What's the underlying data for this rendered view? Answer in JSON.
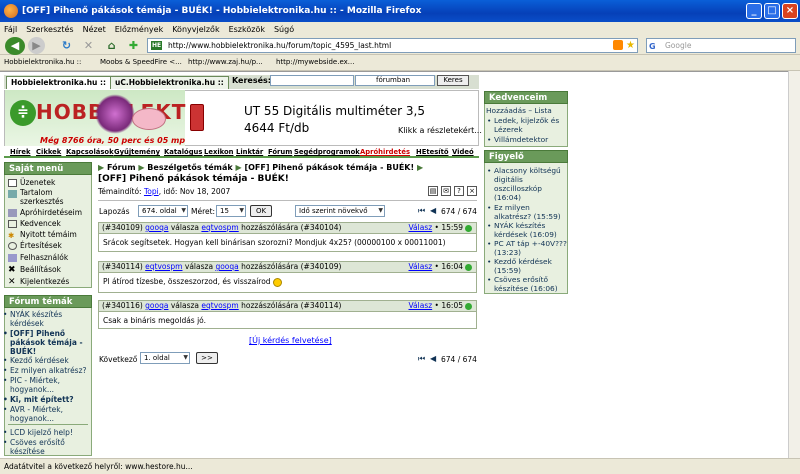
{
  "window": {
    "title": "[OFF] Pihenő pákások témája - BUÉK! - Hobbielektronika.hu :: - Mozilla Firefox"
  },
  "menu": [
    "Fájl",
    "Szerkesztés",
    "Nézet",
    "Előzmények",
    "Könyvjelzők",
    "Eszközök",
    "Súgó"
  ],
  "nav": {
    "url": "http://www.hobbielektronika.hu/forum/topic_4595_last.html",
    "search_placeholder": "Google",
    "url_badge": "HE"
  },
  "bookmarks": [
    "Hobbielektronika.hu ::",
    "Moobs & SpeedFire <...",
    "http://www.zaj.hu/p...",
    "http://mywebside.ex..."
  ],
  "site": {
    "tabs": [
      "Hobbielektronika.hu ::",
      "uC.Hobbielektronika.hu ::"
    ],
    "search_label": "Keresés:",
    "search_scope": "fórumban",
    "search_button": "Keres",
    "logo": "HOBB ELEKT",
    "counter": "Még 8766 óra, 50 perc és 05 mp",
    "ad_title": "UT 55 Digitális multiméter 3,5",
    "ad_price": "4644 Ft/db",
    "ad_click": "Klikk a részletekért...",
    "topnav": [
      "Hírek",
      "Cikkek",
      "Kapcsolások",
      "Gyűjtemény",
      "Katalógus",
      "Lexikon",
      "Linktár",
      "Fórum",
      "Segédprogramok",
      "Apróhirdetés",
      "HEtesítő",
      "Videó"
    ]
  },
  "sajat_menu": {
    "title": "Saját menü",
    "items": [
      "Üzenetek",
      "Tartalom szerkesztés",
      "Apróhirdetéseim",
      "Kedvencek",
      "Nyitott témáim",
      "Értesítések",
      "Felhasználók",
      "Beállítások",
      "Kijelentkezés"
    ]
  },
  "forum_temak": {
    "title": "Fórum témák",
    "items": [
      "NYÁK készítés kérdések",
      "[OFF] Pihenő pákások témája - BUÉK!",
      "Kezdő kérdések",
      "Ez milyen alkatrész?",
      "PIC - Miértek, hogyanok...",
      "Ki, mit épített?",
      "AVR - Miértek, hogyanok...",
      "LCD kijelző help!",
      "Csöves erősítő készítése"
    ]
  },
  "main": {
    "breadcrumb": [
      "Fórum",
      "Beszélgetős témák",
      "[OFF] Pihenő pákások témája - BUÉK!"
    ],
    "topic_title": "[OFF] Pihenő pákások témája - BUÉK!",
    "meta_label": "Témaindító:",
    "meta_user": "Topi",
    "meta_date": ", idő: Nov 18, 2007",
    "lapozas": "Lapozás",
    "page_select": "674. oldal",
    "meret_label": "Méret:",
    "meret_value": "15",
    "ok": "OK",
    "order": "Idő szerint növekvő",
    "page_count": "674 / 674",
    "posts": [
      {
        "id": "(#340109)",
        "user": "gooqa",
        "reply_word": "válasza",
        "to": "eqtvospm",
        "suffix": "hozzászólására",
        "ref": "(#340104)",
        "reply": "Válasz",
        "time": "15:59",
        "text": "Srácok segítsetek. Hogyan kell binárisan szorozni? Mondjuk 4x25? (00000100 x 00011001)"
      },
      {
        "id": "(#340114)",
        "user": "eqtvospm",
        "reply_word": "válasza",
        "to": "gooqa",
        "suffix": "hozzászólására",
        "ref": "(#340109)",
        "reply": "Válasz",
        "time": "16:04",
        "text": "Pl átírod tízesbe, összeszorzod, és visszaírod"
      },
      {
        "id": "(#340116)",
        "user": "gooqa",
        "reply_word": "válasza",
        "to": "eqtvospm",
        "suffix": "hozzászólására",
        "ref": "(#340114)",
        "reply": "Válasz",
        "time": "16:05",
        "text": "Csak a bináris megoldás jó."
      }
    ],
    "new_question": "[Új kérdés felvetése]",
    "next_label": "Következő",
    "next_select": "1. oldal",
    "next_btn": ">>"
  },
  "kedvenceim": {
    "title": "Kedvenceim",
    "add": "Hozzáadás",
    "list": "Lista",
    "items": [
      "Ledek, kijelzők és Lézerek",
      "Villámdetektor"
    ]
  },
  "figyelo": {
    "title": "Figyelő",
    "items": [
      "Alacsony költségű digitális oszcilloszkóp (16:04)",
      "Ez milyen alkatrész? (15:59)",
      "NYÁK készítés kérdések (16:09)",
      "PC AT táp +-40V??? (13:23)",
      "Kezdő kérdések (15:59)",
      "Csöves erősítő készítése (16:06)"
    ]
  },
  "status": "Adatátvitel a következő helyről: www.hestore.hu..."
}
